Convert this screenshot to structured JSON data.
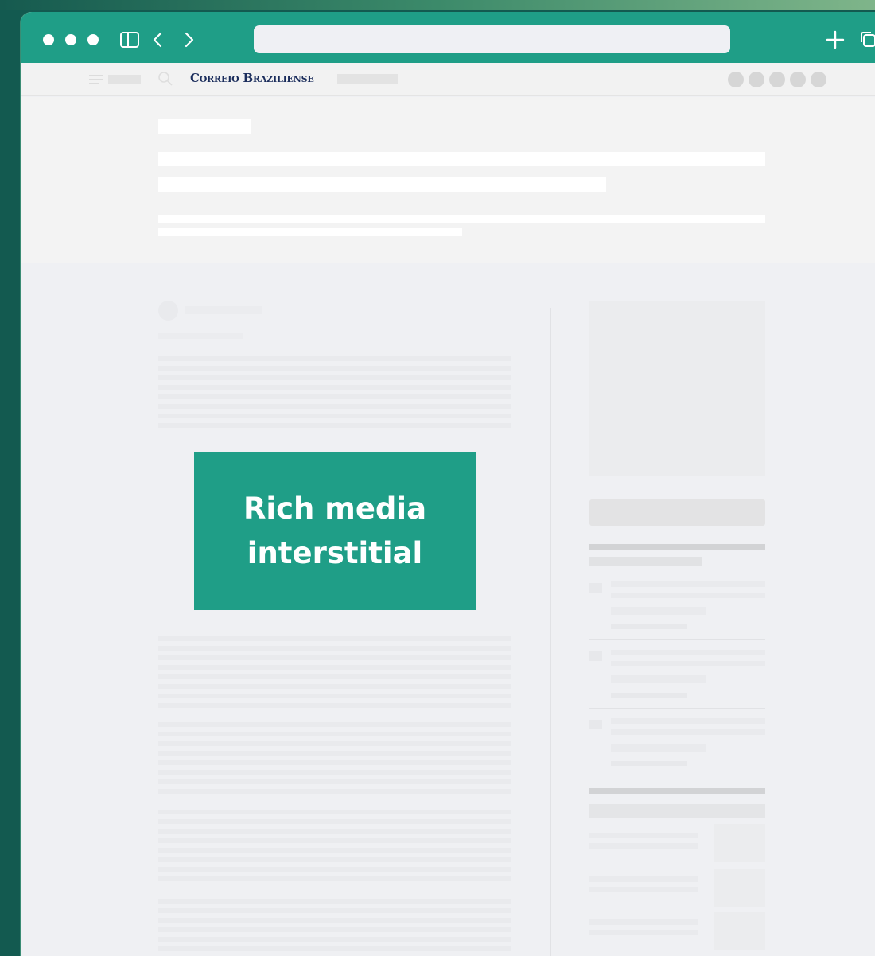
{
  "browser": {
    "url": "",
    "icons": [
      "sidebar-icon",
      "back-icon",
      "forward-icon",
      "new-tab-icon",
      "tabs-overview-icon"
    ]
  },
  "site": {
    "logo_text": "Correio Braziliense",
    "social_icons": [
      "whatsapp-icon",
      "facebook-icon",
      "twitter-icon",
      "instagram-icon",
      "youtube-icon"
    ]
  },
  "ad": {
    "label": "Rich media\ninterstitial",
    "background": "#1f9e87"
  },
  "colors": {
    "accent": "#1f9e87",
    "page_bg": "#eff0f3",
    "outer_bg": "#135a50"
  }
}
